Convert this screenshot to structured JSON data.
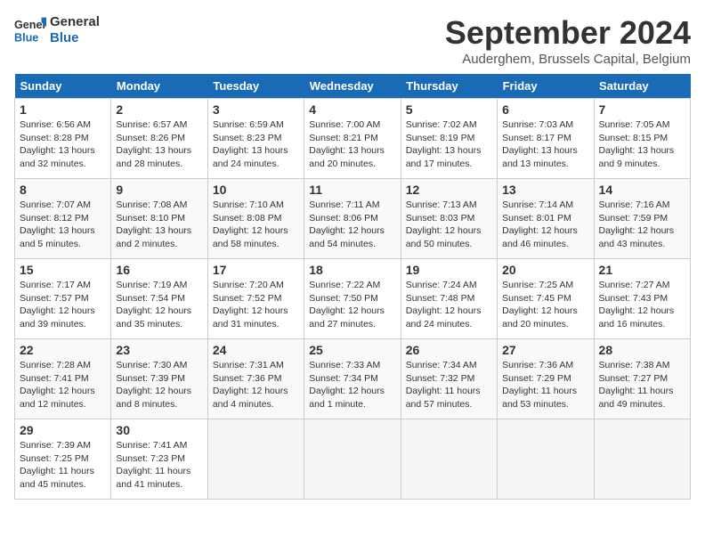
{
  "logo": {
    "line1": "General",
    "line2": "Blue"
  },
  "title": "September 2024",
  "location": "Auderghem, Brussels Capital, Belgium",
  "days_of_week": [
    "Sunday",
    "Monday",
    "Tuesday",
    "Wednesday",
    "Thursday",
    "Friday",
    "Saturday"
  ],
  "weeks": [
    [
      {
        "day": "1",
        "lines": [
          "Sunrise: 6:56 AM",
          "Sunset: 8:28 PM",
          "Daylight: 13 hours",
          "and 32 minutes."
        ]
      },
      {
        "day": "2",
        "lines": [
          "Sunrise: 6:57 AM",
          "Sunset: 8:26 PM",
          "Daylight: 13 hours",
          "and 28 minutes."
        ]
      },
      {
        "day": "3",
        "lines": [
          "Sunrise: 6:59 AM",
          "Sunset: 8:23 PM",
          "Daylight: 13 hours",
          "and 24 minutes."
        ]
      },
      {
        "day": "4",
        "lines": [
          "Sunrise: 7:00 AM",
          "Sunset: 8:21 PM",
          "Daylight: 13 hours",
          "and 20 minutes."
        ]
      },
      {
        "day": "5",
        "lines": [
          "Sunrise: 7:02 AM",
          "Sunset: 8:19 PM",
          "Daylight: 13 hours",
          "and 17 minutes."
        ]
      },
      {
        "day": "6",
        "lines": [
          "Sunrise: 7:03 AM",
          "Sunset: 8:17 PM",
          "Daylight: 13 hours",
          "and 13 minutes."
        ]
      },
      {
        "day": "7",
        "lines": [
          "Sunrise: 7:05 AM",
          "Sunset: 8:15 PM",
          "Daylight: 13 hours",
          "and 9 minutes."
        ]
      }
    ],
    [
      {
        "day": "8",
        "lines": [
          "Sunrise: 7:07 AM",
          "Sunset: 8:12 PM",
          "Daylight: 13 hours",
          "and 5 minutes."
        ]
      },
      {
        "day": "9",
        "lines": [
          "Sunrise: 7:08 AM",
          "Sunset: 8:10 PM",
          "Daylight: 13 hours",
          "and 2 minutes."
        ]
      },
      {
        "day": "10",
        "lines": [
          "Sunrise: 7:10 AM",
          "Sunset: 8:08 PM",
          "Daylight: 12 hours",
          "and 58 minutes."
        ]
      },
      {
        "day": "11",
        "lines": [
          "Sunrise: 7:11 AM",
          "Sunset: 8:06 PM",
          "Daylight: 12 hours",
          "and 54 minutes."
        ]
      },
      {
        "day": "12",
        "lines": [
          "Sunrise: 7:13 AM",
          "Sunset: 8:03 PM",
          "Daylight: 12 hours",
          "and 50 minutes."
        ]
      },
      {
        "day": "13",
        "lines": [
          "Sunrise: 7:14 AM",
          "Sunset: 8:01 PM",
          "Daylight: 12 hours",
          "and 46 minutes."
        ]
      },
      {
        "day": "14",
        "lines": [
          "Sunrise: 7:16 AM",
          "Sunset: 7:59 PM",
          "Daylight: 12 hours",
          "and 43 minutes."
        ]
      }
    ],
    [
      {
        "day": "15",
        "lines": [
          "Sunrise: 7:17 AM",
          "Sunset: 7:57 PM",
          "Daylight: 12 hours",
          "and 39 minutes."
        ]
      },
      {
        "day": "16",
        "lines": [
          "Sunrise: 7:19 AM",
          "Sunset: 7:54 PM",
          "Daylight: 12 hours",
          "and 35 minutes."
        ]
      },
      {
        "day": "17",
        "lines": [
          "Sunrise: 7:20 AM",
          "Sunset: 7:52 PM",
          "Daylight: 12 hours",
          "and 31 minutes."
        ]
      },
      {
        "day": "18",
        "lines": [
          "Sunrise: 7:22 AM",
          "Sunset: 7:50 PM",
          "Daylight: 12 hours",
          "and 27 minutes."
        ]
      },
      {
        "day": "19",
        "lines": [
          "Sunrise: 7:24 AM",
          "Sunset: 7:48 PM",
          "Daylight: 12 hours",
          "and 24 minutes."
        ]
      },
      {
        "day": "20",
        "lines": [
          "Sunrise: 7:25 AM",
          "Sunset: 7:45 PM",
          "Daylight: 12 hours",
          "and 20 minutes."
        ]
      },
      {
        "day": "21",
        "lines": [
          "Sunrise: 7:27 AM",
          "Sunset: 7:43 PM",
          "Daylight: 12 hours",
          "and 16 minutes."
        ]
      }
    ],
    [
      {
        "day": "22",
        "lines": [
          "Sunrise: 7:28 AM",
          "Sunset: 7:41 PM",
          "Daylight: 12 hours",
          "and 12 minutes."
        ]
      },
      {
        "day": "23",
        "lines": [
          "Sunrise: 7:30 AM",
          "Sunset: 7:39 PM",
          "Daylight: 12 hours",
          "and 8 minutes."
        ]
      },
      {
        "day": "24",
        "lines": [
          "Sunrise: 7:31 AM",
          "Sunset: 7:36 PM",
          "Daylight: 12 hours",
          "and 4 minutes."
        ]
      },
      {
        "day": "25",
        "lines": [
          "Sunrise: 7:33 AM",
          "Sunset: 7:34 PM",
          "Daylight: 12 hours",
          "and 1 minute."
        ]
      },
      {
        "day": "26",
        "lines": [
          "Sunrise: 7:34 AM",
          "Sunset: 7:32 PM",
          "Daylight: 11 hours",
          "and 57 minutes."
        ]
      },
      {
        "day": "27",
        "lines": [
          "Sunrise: 7:36 AM",
          "Sunset: 7:29 PM",
          "Daylight: 11 hours",
          "and 53 minutes."
        ]
      },
      {
        "day": "28",
        "lines": [
          "Sunrise: 7:38 AM",
          "Sunset: 7:27 PM",
          "Daylight: 11 hours",
          "and 49 minutes."
        ]
      }
    ],
    [
      {
        "day": "29",
        "lines": [
          "Sunrise: 7:39 AM",
          "Sunset: 7:25 PM",
          "Daylight: 11 hours",
          "and 45 minutes."
        ]
      },
      {
        "day": "30",
        "lines": [
          "Sunrise: 7:41 AM",
          "Sunset: 7:23 PM",
          "Daylight: 11 hours",
          "and 41 minutes."
        ]
      },
      {
        "day": "",
        "lines": [],
        "empty": true
      },
      {
        "day": "",
        "lines": [],
        "empty": true
      },
      {
        "day": "",
        "lines": [],
        "empty": true
      },
      {
        "day": "",
        "lines": [],
        "empty": true
      },
      {
        "day": "",
        "lines": [],
        "empty": true
      }
    ]
  ]
}
